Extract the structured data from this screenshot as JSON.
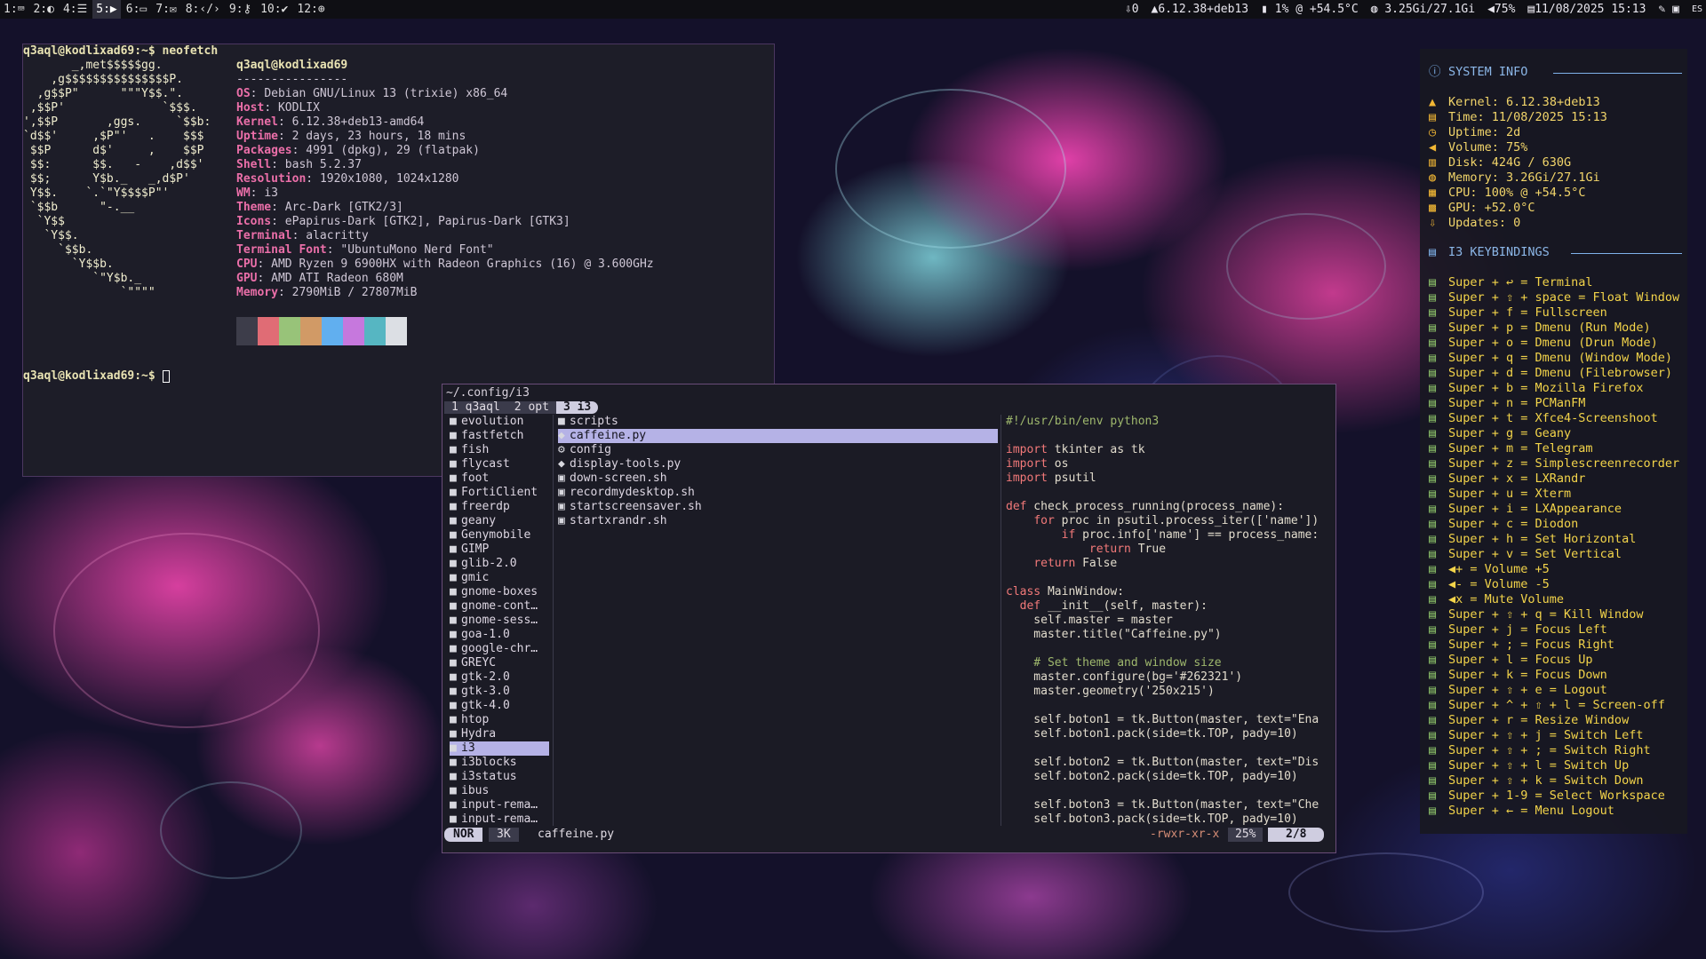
{
  "bar": {
    "workspaces": [
      "1:⌨",
      "2:◐",
      "4:☰",
      "5:▶",
      "6:▭",
      "7:✉",
      "8:‹/›",
      "9:⚷",
      "10:✔",
      "12:⊕"
    ],
    "active_workspace_index": 3,
    "status": {
      "updates": "0",
      "kernel": "6.12.38+deb13",
      "cpu": "1% @ +54.5°C",
      "memory": "3.25Gi/27.1Gi",
      "volume": "75%",
      "datetime": "11/08/2025 15:13",
      "layout": "ES"
    }
  },
  "terminal": {
    "prompt_cmd": "q3aql@kodlixad69:~$ neofetch",
    "prompt_end": "q3aql@kodlixad69:~$",
    "logo": [
      "       _,met$$$$$gg.",
      "    ,g$$$$$$$$$$$$$$$P.",
      "  ,g$$P\"      \"\"\"Y$$.\".",
      " ,$$P'              `$$$.",
      "',$$P       ,ggs.     `$$b:",
      "`d$$'     ,$P\"'   .    $$$",
      " $$P      d$'     ,    $$P",
      " $$:      $$.   -    ,d$$'",
      " $$;      Y$b._   _,d$P'",
      " Y$$.    `.`\"Y$$$$P\"'",
      " `$$b      \"-.__",
      "  `Y$$",
      "   `Y$$.",
      "     `$$b.",
      "       `Y$$b.",
      "          `\"Y$b._",
      "              `\"\"\"\""
    ],
    "user_host": "q3aql@kodlixad69",
    "divider": "----------------",
    "info": [
      {
        "k": "OS",
        "v": "Debian GNU/Linux 13 (trixie) x86_64"
      },
      {
        "k": "Host",
        "v": "KODLIX"
      },
      {
        "k": "Kernel",
        "v": "6.12.38+deb13-amd64"
      },
      {
        "k": "Uptime",
        "v": "2 days, 23 hours, 18 mins"
      },
      {
        "k": "Packages",
        "v": "4991 (dpkg), 29 (flatpak)"
      },
      {
        "k": "Shell",
        "v": "bash 5.2.37"
      },
      {
        "k": "Resolution",
        "v": "1920x1080, 1024x1280"
      },
      {
        "k": "WM",
        "v": "i3"
      },
      {
        "k": "Theme",
        "v": "Arc-Dark [GTK2/3]"
      },
      {
        "k": "Icons",
        "v": "ePapirus-Dark [GTK2], Papirus-Dark [GTK3]"
      },
      {
        "k": "Terminal",
        "v": "alacritty"
      },
      {
        "k": "Terminal Font",
        "v": "\"UbuntuMono Nerd Font\""
      },
      {
        "k": "CPU",
        "v": "AMD Ryzen 9 6900HX with Radeon Graphics (16) @ 3.600GHz"
      },
      {
        "k": "GPU",
        "v": "AMD ATI Radeon 680M"
      },
      {
        "k": "Memory",
        "v": "2790MiB / 27807MiB"
      }
    ],
    "colors": [
      "#3d3d4a",
      "#e06c75",
      "#98c379",
      "#d19a66",
      "#61afef",
      "#c678dd",
      "#56b6c2",
      "#dcdfe4"
    ]
  },
  "fm": {
    "path": "~/.config/i3",
    "tabs": [
      "1 q3aql",
      "2 opt",
      "3 i3"
    ],
    "active_tab": 2,
    "parent": [
      "evolution",
      "fastfetch",
      "fish",
      "flycast",
      "foot",
      "FortiClient",
      "freerdp",
      "geany",
      "Genymobile",
      "GIMP",
      "glib-2.0",
      "gmic",
      "gnome-boxes",
      "gnome-cont…",
      "gnome-sess…",
      "goa-1.0",
      "google-chr…",
      "GREYC",
      "gtk-2.0",
      "gtk-3.0",
      "gtk-4.0",
      "htop",
      "Hydra",
      "i3",
      "i3blocks",
      "i3status",
      "ibus",
      "input-rema…",
      "input-rema…"
    ],
    "parent_selected": 23,
    "current": [
      {
        "icon": "■",
        "name": "scripts"
      },
      {
        "icon": "◆",
        "name": "caffeine.py"
      },
      {
        "icon": "⚙",
        "name": "config"
      },
      {
        "icon": "◆",
        "name": "display-tools.py"
      },
      {
        "icon": "▣",
        "name": "down-screen.sh"
      },
      {
        "icon": "▣",
        "name": "recordmydesktop.sh"
      },
      {
        "icon": "▣",
        "name": "startscreensaver.sh"
      },
      {
        "icon": "▣",
        "name": "startxrandr.sh"
      }
    ],
    "current_selected": 1,
    "status": {
      "mode": "NOR",
      "size": "3K",
      "file": "caffeine.py",
      "perm": "-rwxr-xr-x",
      "percent": "25%",
      "position": "2/8"
    },
    "preview": [
      "#!/usr/bin/env python3",
      "",
      "import tkinter as tk",
      "import os",
      "import psutil",
      "",
      "def check_process_running(process_name):",
      "    for proc in psutil.process_iter(['name'])",
      "        if proc.info['name'] == process_name:",
      "            return True",
      "    return False",
      "",
      "class MainWindow:",
      "  def __init__(self, master):",
      "    self.master = master",
      "    master.title(\"Caffeine.py\")",
      "",
      "    # Set theme and window size",
      "    master.configure(bg='#262321')",
      "    master.geometry('250x215')",
      "",
      "    self.boton1 = tk.Button(master, text=\"Ena",
      "    self.boton1.pack(side=tk.TOP, pady=10)",
      "",
      "    self.boton2 = tk.Button(master, text=\"Dis",
      "    self.boton2.pack(side=tk.TOP, pady=10)",
      "",
      "    self.boton3 = tk.Button(master, text=\"Che",
      "    self.boton3.pack(side=tk.TOP, pady=10)"
    ]
  },
  "conky": {
    "sys_header": "SYSTEM INFO",
    "sys": [
      {
        "k": "Kernel:",
        "v": "6.12.38+deb13",
        "icon": "▲"
      },
      {
        "k": "Time:",
        "v": "11/08/2025 15:13",
        "icon": "▤"
      },
      {
        "k": "Uptime:",
        "v": "2d",
        "icon": "◷"
      },
      {
        "k": "Volume:",
        "v": "75%",
        "icon": "◀"
      },
      {
        "k": "Disk:",
        "v": "424G / 630G",
        "icon": "▥"
      },
      {
        "k": "Memory:",
        "v": "3.26Gi/27.1Gi",
        "icon": "◍"
      },
      {
        "k": "CPU:",
        "v": "  100% @ +54.5°C",
        "icon": "▦"
      },
      {
        "k": "GPU:",
        "v": "+52.0°C",
        "icon": "▩"
      },
      {
        "k": "Updates:",
        "v": "0",
        "icon": "⇩"
      }
    ],
    "keys_header": "I3 KEYBINDINGS",
    "keys": [
      "Super + ↩ = Terminal",
      "Super + ⇧ + space = Float Window",
      "Super + f = Fullscreen",
      "Super + p = Dmenu (Run Mode)",
      "Super + o = Dmenu (Drun Mode)",
      "Super + q = Dmenu (Window Mode)",
      "Super + d = Dmenu (Filebrowser)",
      "Super + b = Mozilla Firefox",
      "Super + n = PCManFM",
      "Super + t = Xfce4-Screenshoot",
      "Super + g = Geany",
      "Super + m = Telegram",
      "Super + z = Simplescreenrecorder",
      "Super + x = LXRandr",
      "Super + u = Xterm",
      "Super + i = LXAppearance",
      "Super + c = Diodon",
      "Super + h = Set Horizontal",
      "Super + v = Set Vertical",
      "◀+ = Volume +5",
      "◀- = Volume -5",
      "◀x = Mute Volume",
      "Super + ⇧ + q = Kill Window",
      "Super + j = Focus Left",
      "Super + ; = Focus Right",
      "Super + l = Focus Up",
      "Super + k = Focus Down",
      "Super + ⇧ + e = Logout",
      "Super + ^ + ⇧ + l = Screen-off",
      "Super + r = Resize Window",
      "Super + ⇧ + j = Switch Left",
      "Super + ⇧ + ; = Switch Right",
      "Super + ⇧ + l = Switch Up",
      "Super + ⇧ + k = Switch Down",
      "Super + 1-9 = Select Workspace",
      "Super + ← = Menu Logout"
    ]
  }
}
